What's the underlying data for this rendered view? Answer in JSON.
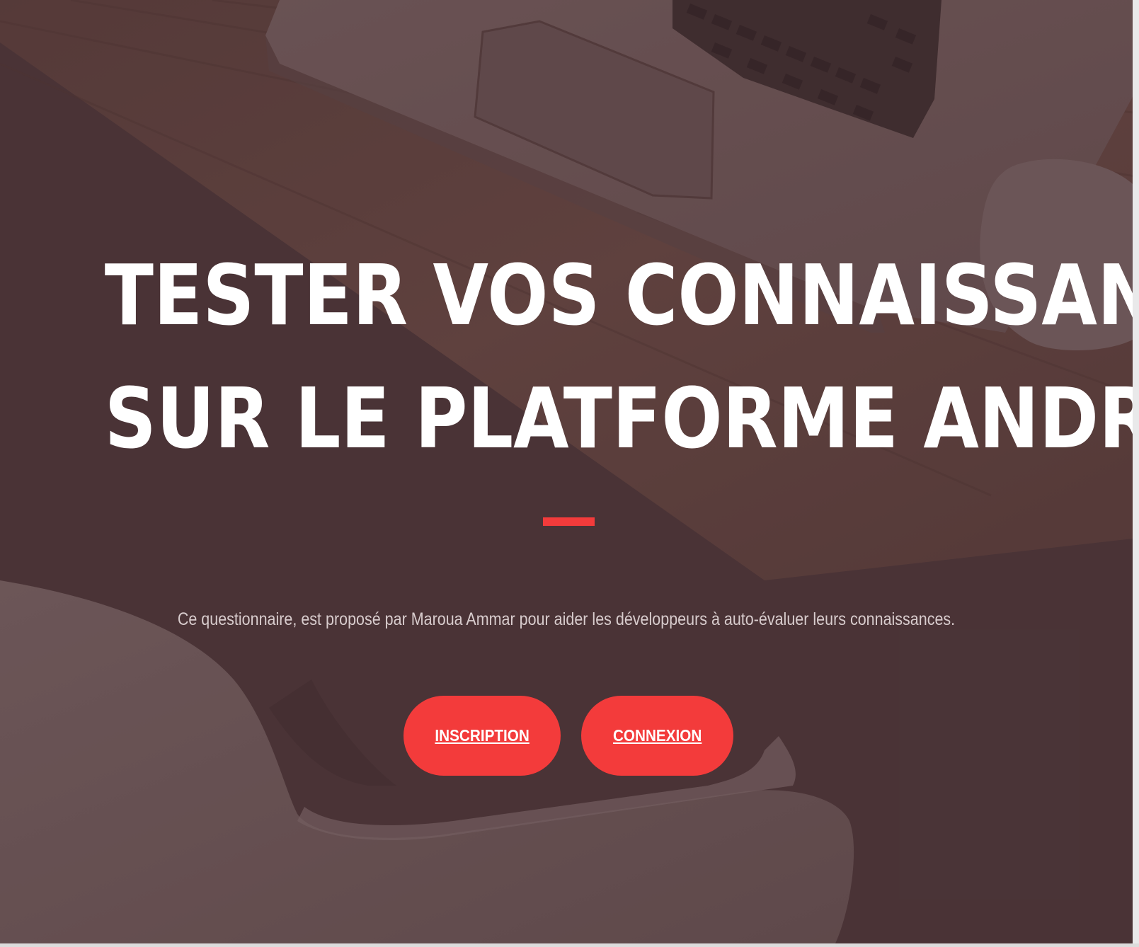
{
  "hero": {
    "headline_line1": "TESTER VOS CONNAISSANCES",
    "headline_line2": "SUR LE PLATFORME ANDROID",
    "tagline": "Ce questionnaire, est proposé par Maroua Ammar pour aider les développeurs à auto-évaluer leurs connaissances.",
    "background_image": "desk-laptop-photo",
    "accent_color": "#f33b3b",
    "overlay_color": "#4a3537"
  },
  "actions": {
    "inscription_label": "INSCRIPTION",
    "connexion_label": "CONNEXION"
  }
}
